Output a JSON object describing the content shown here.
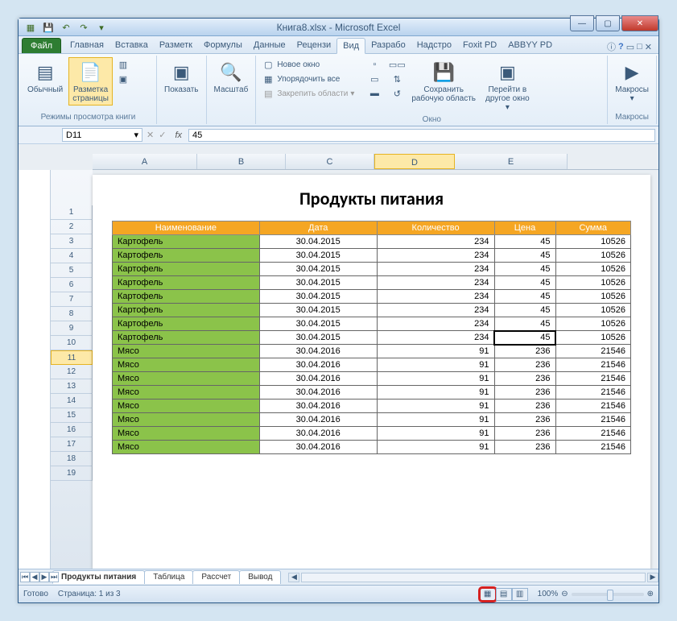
{
  "window": {
    "title": "Книга8.xlsx - Microsoft Excel"
  },
  "qat": {
    "save": "💾",
    "undo": "↶",
    "redo": "↷"
  },
  "ribbon": {
    "file": "Файл",
    "tabs": [
      "Главная",
      "Вставка",
      "Разметк",
      "Формулы",
      "Данные",
      "Рецензи",
      "Вид",
      "Разрабо",
      "Надстро",
      "Foxit PD",
      "ABBYY PD"
    ],
    "active_tab_index": 6,
    "help_icons": [
      "ⓘ",
      "?",
      "▢",
      "✕"
    ],
    "groups": {
      "views": {
        "normal": "Обычный",
        "page_layout": "Разметка\nстраницы",
        "show": "Показать",
        "zoom": "Масштаб",
        "label": "Режимы просмотра книги"
      },
      "window": {
        "new_window": "Новое окно",
        "arrange": "Упорядочить все",
        "freeze": "Закрепить области",
        "save_workspace": "Сохранить\nрабочую область",
        "switch_windows": "Перейти в\nдругое окно",
        "label": "Окно"
      },
      "macros": {
        "btn": "Макросы",
        "label": "Макросы"
      }
    }
  },
  "namebox": "D11",
  "formula": "45",
  "columns": [
    "A",
    "B",
    "C",
    "D",
    "E"
  ],
  "row_numbers": [
    1,
    2,
    3,
    4,
    5,
    6,
    7,
    8,
    9,
    10,
    11,
    12,
    13,
    14,
    15,
    16,
    17,
    18,
    19
  ],
  "selected_row": 11,
  "page_title": "Продукты питания",
  "table": {
    "headers": [
      "Наименование",
      "Дата",
      "Количество",
      "Цена",
      "Сумма"
    ],
    "rows": [
      [
        "Картофель",
        "30.04.2015",
        234,
        45,
        10526
      ],
      [
        "Картофель",
        "30.04.2015",
        234,
        45,
        10526
      ],
      [
        "Картофель",
        "30.04.2015",
        234,
        45,
        10526
      ],
      [
        "Картофель",
        "30.04.2015",
        234,
        45,
        10526
      ],
      [
        "Картофель",
        "30.04.2015",
        234,
        45,
        10526
      ],
      [
        "Картофель",
        "30.04.2015",
        234,
        45,
        10526
      ],
      [
        "Картофель",
        "30.04.2015",
        234,
        45,
        10526
      ],
      [
        "Картофель",
        "30.04.2015",
        234,
        45,
        10526
      ],
      [
        "Мясо",
        "30.04.2016",
        91,
        236,
        21546
      ],
      [
        "Мясо",
        "30.04.2016",
        91,
        236,
        21546
      ],
      [
        "Мясо",
        "30.04.2016",
        91,
        236,
        21546
      ],
      [
        "Мясо",
        "30.04.2016",
        91,
        236,
        21546
      ],
      [
        "Мясо",
        "30.04.2016",
        91,
        236,
        21546
      ],
      [
        "Мясо",
        "30.04.2016",
        91,
        236,
        21546
      ],
      [
        "Мясо",
        "30.04.2016",
        91,
        236,
        21546
      ],
      [
        "Мясо",
        "30.04.2016",
        91,
        236,
        21546
      ]
    ],
    "selected_cell": {
      "row": 7,
      "col": 3
    }
  },
  "sheet_tabs": [
    "Продукты питания",
    "Таблица",
    "Рассчет",
    "Вывод"
  ],
  "status": {
    "ready": "Готово",
    "page": "Страница: 1 из 3",
    "zoom": "100%"
  }
}
